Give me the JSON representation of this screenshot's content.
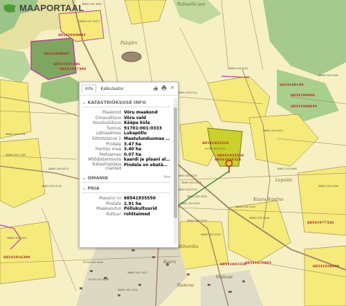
{
  "app": {
    "name": "MAAPORTAAL"
  },
  "map": {
    "place_labels": [
      "Rabasilla soo",
      "Palojärv",
      "Lepaüla",
      "Kuura-Rastino",
      "Hõvaviku",
      "Kaaru",
      "Risteme",
      "Veskuse"
    ],
    "parcel_codes_red": [
      "68541948847",
      "68541947246",
      "68541947300",
      "6854194/0001",
      "6854190199",
      "6854199960",
      "68541932224",
      "68541938324",
      "68541935550",
      "68541916309",
      "68541968049",
      "68541977358",
      "68541883338",
      "68541839665",
      "68541938640"
    ],
    "parcel_codes_small": [
      "38601 002 1891",
      "38601 002 1070",
      "38601 002 1180",
      "38601 002 0110",
      "38601 002 0021",
      "38601 002 0220",
      "38601 002 0240",
      "38601 002 0270",
      "38601 002 0300",
      "38601 002 0321",
      "38601 002 1100",
      "38601 002 1140",
      "38601 002 0330",
      "38601 002 0350",
      "38601 002 1201",
      "38601 002 0410",
      "38601 002 0460",
      "38601 002 0061",
      "91701 001 0444",
      "91701 001 0009",
      "38601 002 0190",
      "38601 002 0210",
      "38601 002 0235",
      "38601 002 1012",
      "38601 002 1020",
      "38601 002 0560",
      "91701 001 0333"
    ]
  },
  "popup": {
    "tabs": [
      "Info",
      "Kalkulaator"
    ],
    "section_katastri": "KATASTRIÜKSUSE INFO",
    "rows": [
      {
        "k": "Maakond",
        "v": "Võru maakond"
      },
      {
        "k": "Omavalitsus",
        "v": "Võru vald"
      },
      {
        "k": "Asustusüksus",
        "v": "Kääpa küla"
      },
      {
        "k": "Tunnus",
        "v": "91701:001:0333"
      },
      {
        "k": "Lähiaadress",
        "v": "Lukapõllu"
      },
      {
        "k": "Sihtotstarve 1",
        "v": "Maatulundusmaa 1..."
      },
      {
        "k": "Pindala",
        "v": "3.47 ha"
      },
      {
        "k": "Haritav maa",
        "v": "3.40 ha"
      },
      {
        "k": "Metsamaa",
        "v": "0.07 ha"
      },
      {
        "k": "Mõõdistamisviis",
        "v": "kaardi je plaani ali..."
      },
      {
        "k": "Katastripidaja märked",
        "v": "Pindala on ebatäpn..."
      }
    ],
    "section_omanik": "OMANIK",
    "omanik_right": "Ava",
    "section_pria": "PRIA",
    "pria_rows": [
      {
        "k": "Massiivi nr",
        "v": "68541935550"
      },
      {
        "k": "Pindala",
        "v": "2.91 ha"
      },
      {
        "k": "Maakasutus",
        "v": "Põllukultuurid"
      },
      {
        "k": "Kultuur",
        "v": "rohttaimed"
      }
    ]
  },
  "colors": {
    "field": "#f6efb3",
    "parcel_yellow": "#f5ea7a",
    "green": "#8cc47a",
    "selected": "#c9d12a",
    "road": "#a48a68",
    "magenta": "#c13aa8",
    "label_red": "#b22222"
  }
}
